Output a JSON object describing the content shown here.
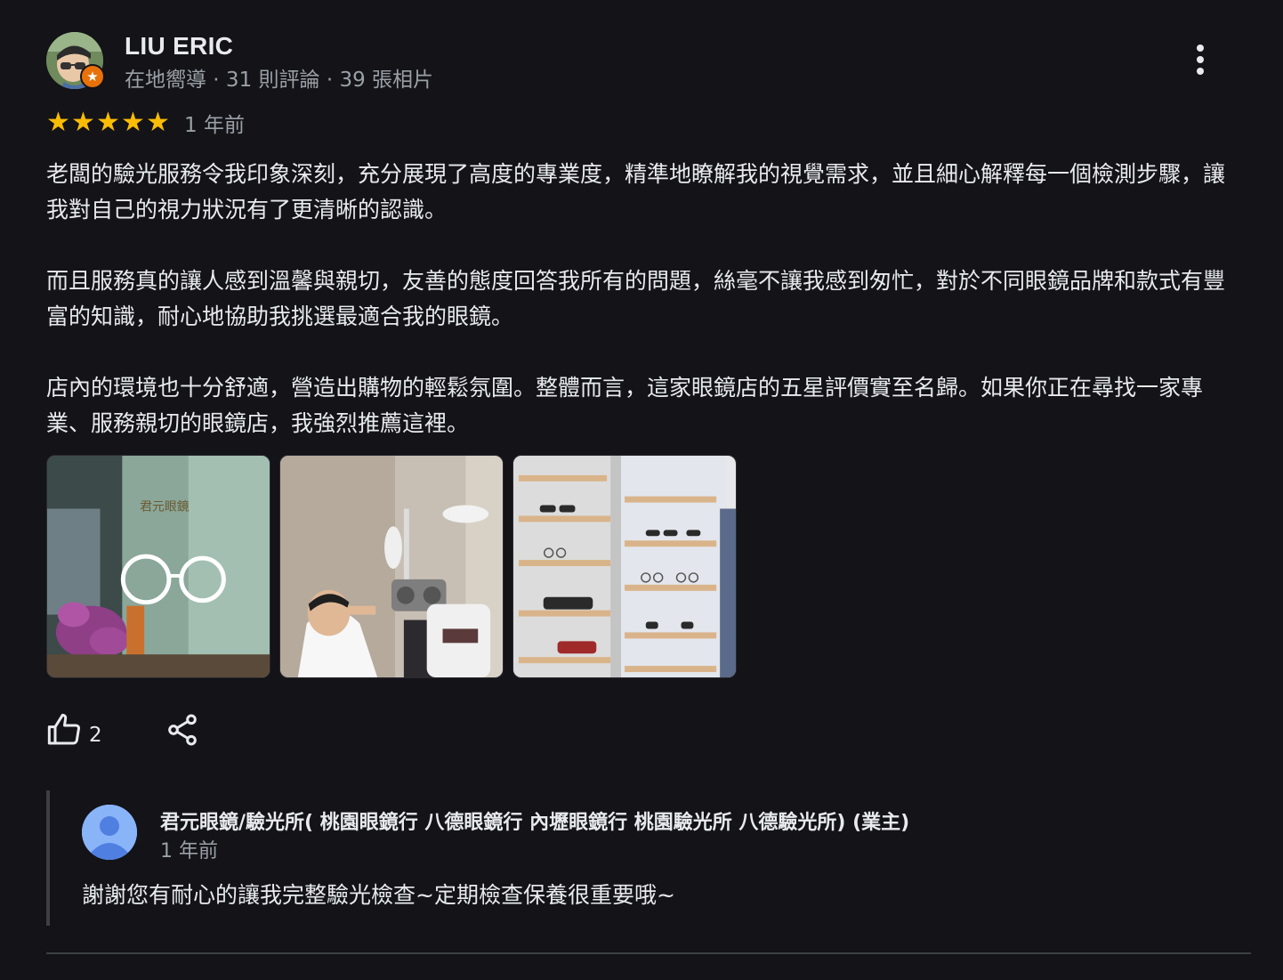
{
  "review": {
    "reviewer_name": "LIU ERIC",
    "reviewer_meta": "在地嚮導 · 31 則評論 · 39 張相片",
    "badge_icon": "star-badge-icon",
    "star_rating": 5,
    "star_max": 5,
    "time": "1 年前",
    "paragraphs": [
      "老闆的驗光服務令我印象深刻，充分展現了高度的專業度，精準地瞭解我的視覺需求，並且細心解釋每一個檢測步驟，讓我對自己的視力狀況有了更清晰的認識。",
      "而且服務真的讓人感到溫馨與親切，友善的態度回答我所有的問題，絲毫不讓我感到匆忙，對於不同眼鏡品牌和款式有豐富的知識，耐心地協助我挑選最適合我的眼鏡。",
      "店內的環境也十分舒適，營造出購物的輕鬆氛圍。整體而言，這家眼鏡店的五星評價實至名歸。如果你正在尋找一家專業、服務親切的眼鏡店，我強烈推薦這裡。"
    ],
    "photo_storefront_sign": "君元眼鏡",
    "like_count": "2"
  },
  "owner_reply": {
    "name": "君元眼鏡/驗光所( 桃園眼鏡行 八德眼鏡行 內壢眼鏡行 桃園驗光所 八德驗光所) (業主)",
    "time": "1 年前",
    "text": "謝謝您有耐心的讓我完整驗光檢查~定期檢查保養很重要哦~"
  },
  "colors": {
    "background": "#131318",
    "star": "#fbbc04",
    "badge": "#e8710a",
    "owner_avatar": "#8ab4f8",
    "secondary_text": "#9aa0a6"
  }
}
